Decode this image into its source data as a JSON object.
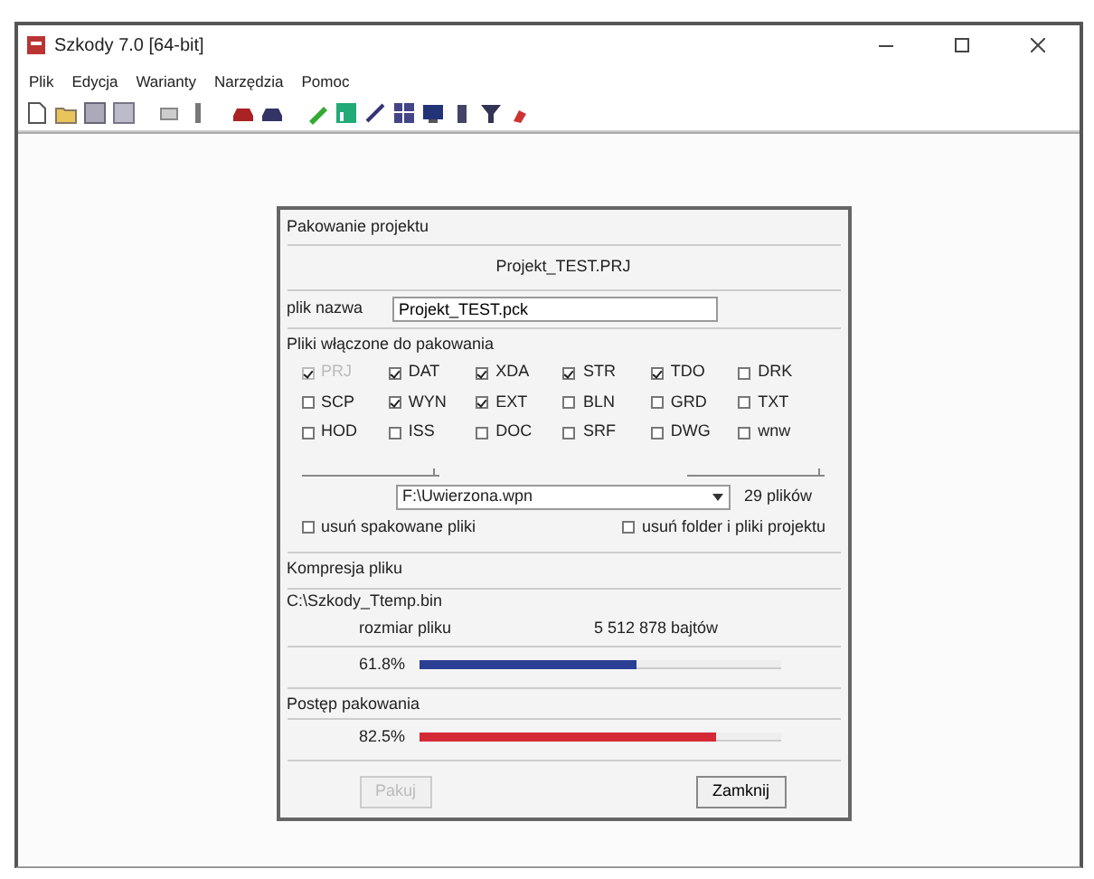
{
  "window": {
    "title": "Szkody 7.0 [64-bit]"
  },
  "menu": [
    "Plik",
    "Edycja",
    "Warianty",
    "Narzędzia",
    "Pomoc"
  ],
  "dialog": {
    "title": "Pakowanie projektu",
    "project": "Projekt_TEST.PRJ",
    "name_label": "plik nazwa",
    "name_value": "Projekt_TEST.pck",
    "files_label": "Pliki włączone do pakowania",
    "files": [
      {
        "label": "PRJ",
        "checked": true,
        "disabled": true
      },
      {
        "label": "DAT",
        "checked": true,
        "disabled": false
      },
      {
        "label": "XDA",
        "checked": true,
        "disabled": false
      },
      {
        "label": "STR",
        "checked": true,
        "disabled": false
      },
      {
        "label": "TDO",
        "checked": true,
        "disabled": false
      },
      {
        "label": "DRK",
        "checked": false,
        "disabled": false
      },
      {
        "label": "SCP",
        "checked": false,
        "disabled": false
      },
      {
        "label": "WYN",
        "checked": true,
        "disabled": false
      },
      {
        "label": "EXT",
        "checked": true,
        "disabled": false
      },
      {
        "label": "BLN",
        "checked": false,
        "disabled": false
      },
      {
        "label": "GRD",
        "checked": false,
        "disabled": false
      },
      {
        "label": "TXT",
        "checked": false,
        "disabled": false
      },
      {
        "label": "HOD",
        "checked": false,
        "disabled": false
      },
      {
        "label": "ISS",
        "checked": false,
        "disabled": false
      },
      {
        "label": "DOC",
        "checked": false,
        "disabled": false
      },
      {
        "label": "SRF",
        "checked": false,
        "disabled": false
      },
      {
        "label": "DWG",
        "checked": false,
        "disabled": false
      },
      {
        "label": "wnw",
        "checked": false,
        "disabled": false
      }
    ],
    "folder": "F:\\Uwierzona.wpn",
    "file_count": "29 plików",
    "options": [
      {
        "label": "usuń spakowane pliki",
        "checked": false
      },
      {
        "label": "usuń folder i pliki projektu",
        "checked": false
      }
    ],
    "compression": {
      "label": "Kompresja pliku",
      "path": "C:\\Szkody_Ttemp.bin",
      "size_label": "rozmiar pliku",
      "size_value": "5 512 878 bajtów",
      "percent": "61.8%",
      "level": 0.6
    },
    "progress": {
      "label": "Postęp pakowania",
      "percent": "82.5%",
      "level": 0.82
    },
    "buttons": [
      {
        "label": "Pakuj",
        "disabled": true
      },
      {
        "label": "Zamknij",
        "disabled": false
      }
    ]
  }
}
